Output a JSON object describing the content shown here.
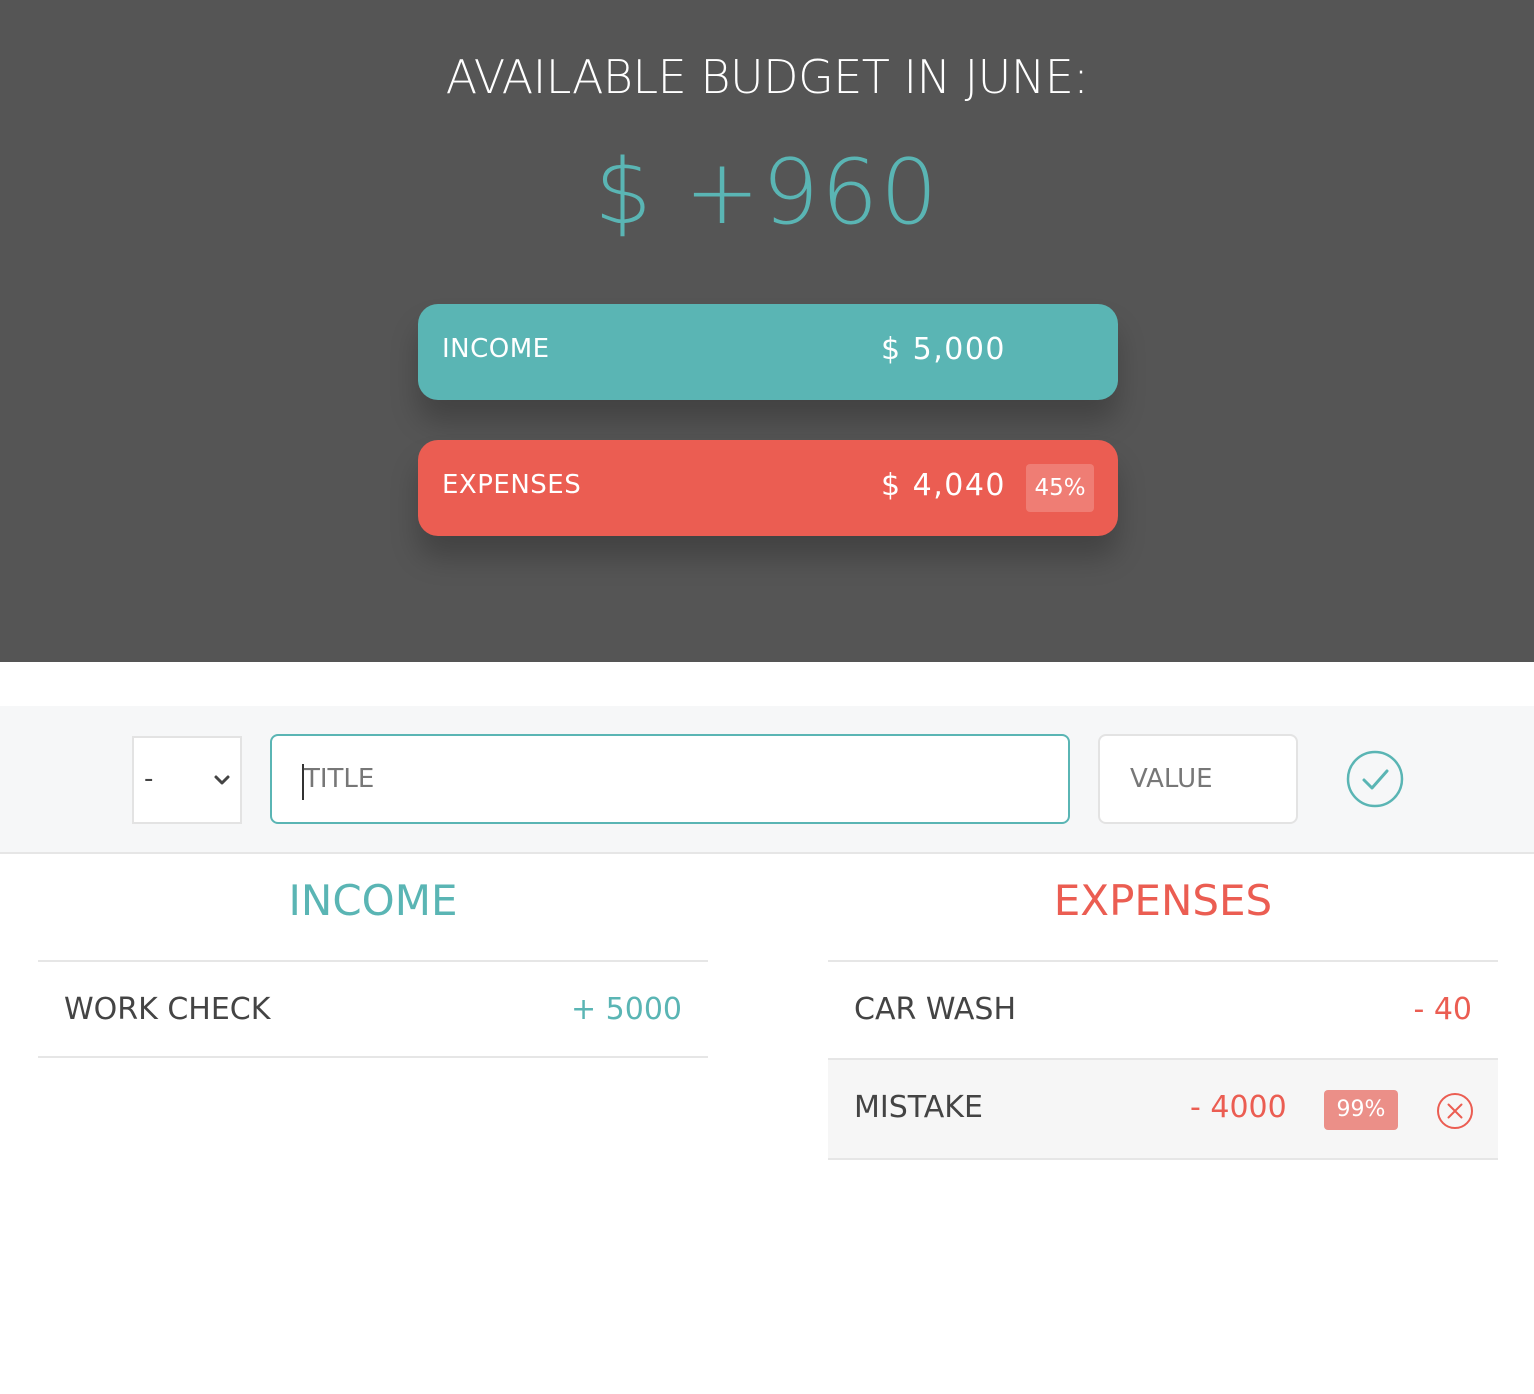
{
  "header": {
    "title": "AVAILABLE BUDGET IN JUNE:",
    "total": "$ +960",
    "income": {
      "label": "INCOME",
      "value": "$ 5,000"
    },
    "expenses": {
      "label": "EXPENSES",
      "value": "$ 4,040",
      "percentage": "45%"
    }
  },
  "add_form": {
    "type_value": "-",
    "title_placeholder": "TITLE",
    "value_placeholder": "VALUE",
    "submit_icon": "check-circle-icon"
  },
  "income_list": {
    "heading": "INCOME",
    "items": [
      {
        "title": "WORK CHECK",
        "value": "+ 5000"
      }
    ]
  },
  "expenses_list": {
    "heading": "EXPENSES",
    "items": [
      {
        "title": "CAR WASH",
        "value": "- 40"
      },
      {
        "title": "MISTAKE",
        "value": "- 4000",
        "percentage": "99%",
        "delete_icon": "close-circle-icon"
      }
    ]
  },
  "colors": {
    "income": "#5ab5b4",
    "expenses": "#eb5d52",
    "header_bg": "#555555"
  }
}
